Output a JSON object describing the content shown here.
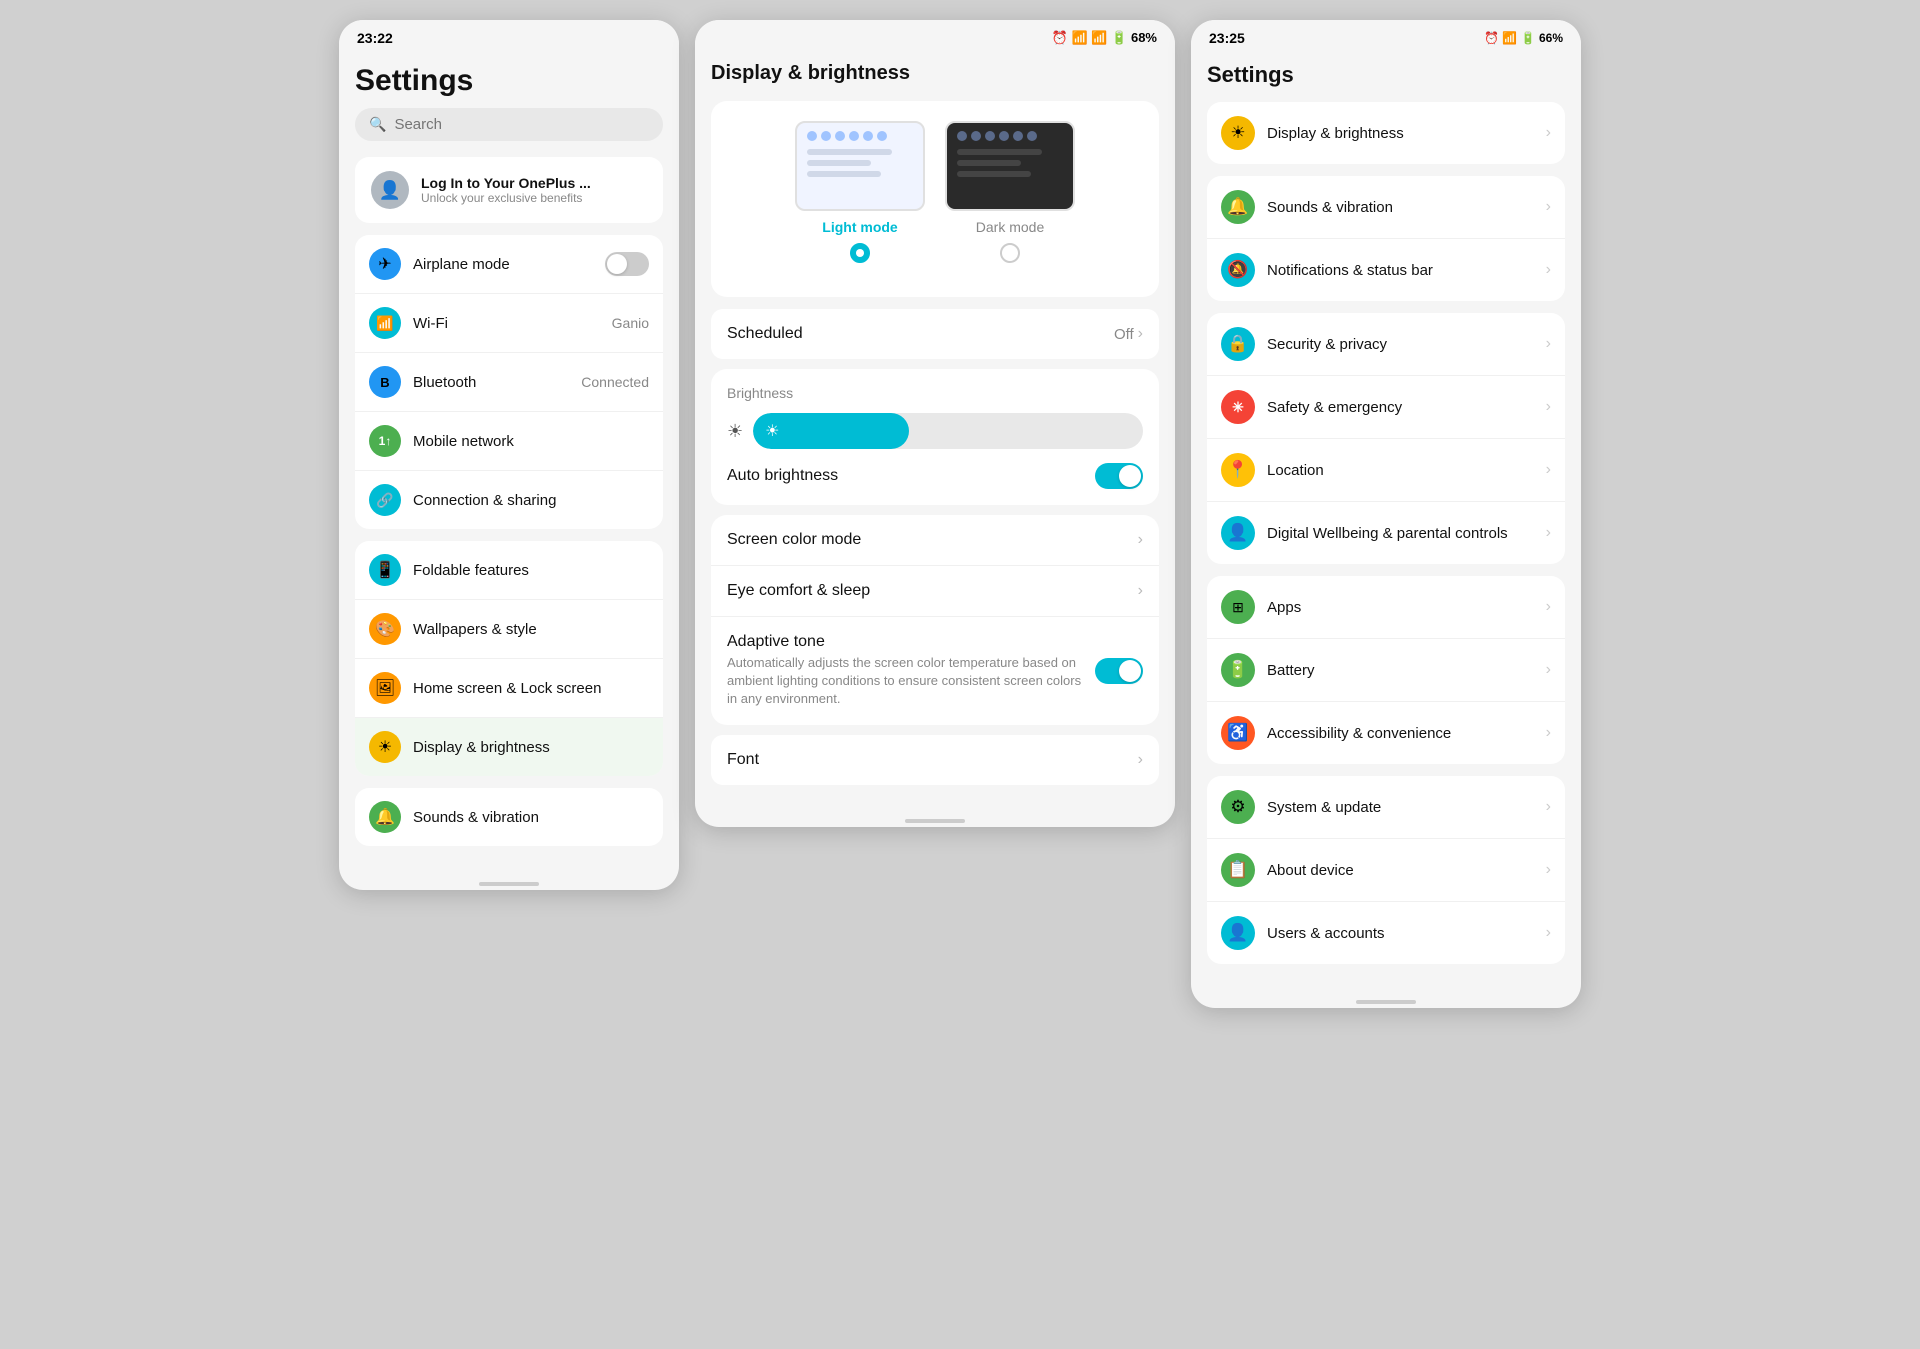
{
  "leftPanel": {
    "statusBar": {
      "time": "23:22"
    },
    "title": "Settings",
    "search": {
      "placeholder": "Search"
    },
    "loginCard": {
      "title": "Log In to Your OnePlus ...",
      "subtitle": "Unlock your exclusive benefits"
    },
    "groups": [
      {
        "id": "connectivity",
        "items": [
          {
            "id": "airplane",
            "label": "Airplane mode",
            "icon": "✈",
            "iconClass": "ic-blue",
            "control": "toggle",
            "toggleOn": false
          },
          {
            "id": "wifi",
            "label": "Wi-Fi",
            "icon": "📶",
            "iconClass": "ic-teal",
            "value": "Ganio"
          },
          {
            "id": "bluetooth",
            "label": "Bluetooth",
            "icon": "🅱",
            "iconClass": "ic-blue",
            "value": "Connected"
          },
          {
            "id": "mobile",
            "label": "Mobile network",
            "icon": "1↑",
            "iconClass": "ic-green"
          },
          {
            "id": "connection",
            "label": "Connection & sharing",
            "icon": "🔗",
            "iconClass": "ic-teal"
          }
        ]
      },
      {
        "id": "customization",
        "items": [
          {
            "id": "foldable",
            "label": "Foldable features",
            "icon": "📱",
            "iconClass": "ic-teal"
          },
          {
            "id": "wallpaper",
            "label": "Wallpapers & style",
            "icon": "🎨",
            "iconClass": "ic-orange"
          },
          {
            "id": "homescreen",
            "label": "Home screen & Lock screen",
            "icon": "🖼",
            "iconClass": "ic-orange"
          },
          {
            "id": "display",
            "label": "Display & brightness",
            "icon": "☀",
            "iconClass": "ic-yellow",
            "active": true
          }
        ]
      }
    ],
    "partialItem": {
      "label": "Sounds & vibration",
      "icon": "🔔",
      "iconClass": "ic-green"
    }
  },
  "middlePanel": {
    "statusBar": {
      "icons": "⏰ 📶 🔋 68%"
    },
    "title": "Display & brightness",
    "modeSelector": {
      "lightMode": {
        "label": "Light mode",
        "active": true
      },
      "darkMode": {
        "label": "Dark mode",
        "active": false
      }
    },
    "scheduled": {
      "label": "Scheduled",
      "value": "Off"
    },
    "brightness": {
      "label": "Brightness",
      "fillPercent": 40,
      "autoLabel": "Auto brightness",
      "autoOn": true
    },
    "listItems": [
      {
        "id": "screen-color",
        "title": "Screen color mode",
        "sub": ""
      },
      {
        "id": "eye-comfort",
        "title": "Eye comfort & sleep",
        "sub": ""
      },
      {
        "id": "adaptive-tone",
        "title": "Adaptive tone",
        "sub": "Automatically adjusts the screen color temperature based on ambient lighting conditions to ensure consistent screen colors in any environment.",
        "toggleOn": true
      }
    ],
    "fontItem": {
      "title": "Font"
    }
  },
  "rightPanel": {
    "statusBar": {
      "time": "23:25",
      "icons": "⏰ 📶 🔋 66%"
    },
    "title": "Settings",
    "groups": [
      {
        "id": "display-group",
        "items": [
          {
            "id": "display",
            "label": "Display & brightness",
            "icon": "☀",
            "iconClass": "ic-yellow"
          }
        ]
      },
      {
        "id": "sound-group",
        "items": [
          {
            "id": "sounds",
            "label": "Sounds & vibration",
            "icon": "🔔",
            "iconClass": "ic-green"
          },
          {
            "id": "notifications",
            "label": "Notifications & status bar",
            "icon": "🔕",
            "iconClass": "ic-teal"
          }
        ]
      },
      {
        "id": "security-group",
        "items": [
          {
            "id": "security",
            "label": "Security & privacy",
            "icon": "🔒",
            "iconClass": "ic-teal"
          },
          {
            "id": "safety",
            "label": "Safety & emergency",
            "icon": "✳",
            "iconClass": "ic-red"
          },
          {
            "id": "location",
            "label": "Location",
            "icon": "📍",
            "iconClass": "ic-amber"
          },
          {
            "id": "digital",
            "label": "Digital Wellbeing & parental controls",
            "icon": "👤",
            "iconClass": "ic-teal"
          }
        ]
      },
      {
        "id": "apps-group",
        "items": [
          {
            "id": "apps",
            "label": "Apps",
            "icon": "⊞",
            "iconClass": "ic-green"
          },
          {
            "id": "battery",
            "label": "Battery",
            "icon": "🔋",
            "iconClass": "ic-green"
          },
          {
            "id": "accessibility",
            "label": "Accessibility & convenience",
            "icon": "♿",
            "iconClass": "ic-deep-orange"
          }
        ]
      },
      {
        "id": "system-group",
        "items": [
          {
            "id": "system",
            "label": "System & update",
            "icon": "⚙",
            "iconClass": "ic-green"
          },
          {
            "id": "about",
            "label": "About device",
            "icon": "📋",
            "iconClass": "ic-green"
          },
          {
            "id": "users",
            "label": "Users & accounts",
            "icon": "👤",
            "iconClass": "ic-teal"
          }
        ]
      }
    ]
  }
}
